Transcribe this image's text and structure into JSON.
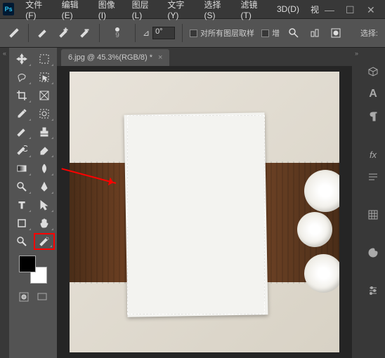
{
  "app": {
    "logo": "Ps"
  },
  "menu": [
    "文件(F)",
    "编辑(E)",
    "图像(I)",
    "图层(L)",
    "文字(Y)",
    "选择(S)",
    "滤镜(T)",
    "3D(D)",
    "视"
  ],
  "optbar": {
    "brush_size": "9",
    "angle_label": "⊿",
    "angle_value": "0°",
    "sample_all_label": "对所有图层取样",
    "enhance_label": "增",
    "select_subject": "选择:"
  },
  "document": {
    "tab_label": "6.jpg @ 45.3%(RGB/8) *",
    "tab_close": "×"
  },
  "right_panel_icons": [
    "cube",
    "text-A",
    "paragraph",
    "fx",
    "paragraph-style",
    "grid",
    "swatches",
    "adjustments"
  ]
}
